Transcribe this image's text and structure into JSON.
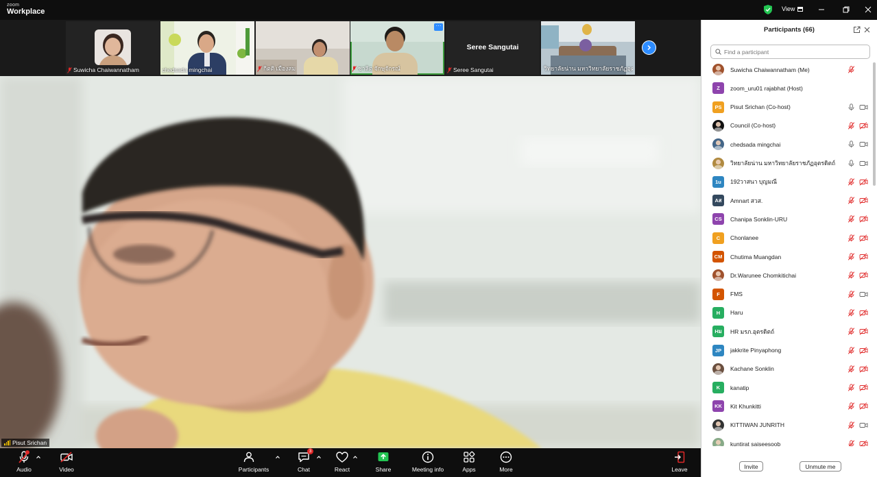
{
  "app": {
    "logo_small": "zoom",
    "logo_big": "Workplace",
    "view_label": "View"
  },
  "colors": {
    "accent": "#2d8cff",
    "muted_red": "#e02828",
    "share_green": "#23c552"
  },
  "thumbnails": [
    {
      "name": "Suwicha Chaiwannatham",
      "muted": true
    },
    {
      "name": "chedsada mingchai",
      "muted": false
    },
    {
      "name": "กิตติ เมืองสม",
      "muted": true
    },
    {
      "name": "ชาลิต จักษุจักรณ์",
      "muted": true
    },
    {
      "name": "Seree Sangutai",
      "muted": true,
      "center_text": "Seree Sangutai"
    },
    {
      "name": "วิทยาลัยน่าน มหาวิทยาลัยราชภัฏอุตรด...",
      "muted": true
    }
  ],
  "main": {
    "speaker_name": "Pisut Srichan"
  },
  "toolbar": {
    "audio": "Audio",
    "video": "Video",
    "participants": "Participants",
    "participants_count": "66",
    "chat": "Chat",
    "chat_badge": "3",
    "react": "React",
    "share": "Share",
    "meeting_info": "Meeting info",
    "apps": "Apps",
    "more": "More",
    "leave": "Leave"
  },
  "panel": {
    "title": "Participants (66)",
    "search_placeholder": "Find a participant",
    "invite": "Invite",
    "unmute_me": "Unmute me",
    "participants": [
      {
        "name": "Suwicha Chaiwannatham (Me)",
        "initials": "",
        "color": "#a0522d",
        "photo": true,
        "mic": "muted",
        "cam": "none"
      },
      {
        "name": "zoom_uru01 rajabhat (Host)",
        "initials": "Z",
        "color": "#8e44ad",
        "photo": false,
        "mic": "none",
        "cam": "none"
      },
      {
        "name": "Pisut Srichan (Co-host)",
        "initials": "PS",
        "color": "#f0a020",
        "photo": false,
        "mic": "on",
        "cam": "on"
      },
      {
        "name": "Council (Co-host)",
        "initials": "",
        "color": "#111111",
        "photo": true,
        "mic": "muted",
        "cam": "off"
      },
      {
        "name": "chedsada mingchai",
        "initials": "",
        "color": "#446688",
        "photo": true,
        "mic": "on",
        "cam": "on"
      },
      {
        "name": "วิทยาลัยน่าน มหาวิทยาลัยราชภัฏอุตรดิตถ์",
        "initials": "",
        "color": "#b08a40",
        "photo": true,
        "mic": "on",
        "cam": "on"
      },
      {
        "name": "192วาสนา บุญมณี",
        "initials": "1u",
        "color": "#2e86c1",
        "photo": false,
        "mic": "muted",
        "cam": "off"
      },
      {
        "name": "Amnart สวส.",
        "initials": "Aส",
        "color": "#34495e",
        "photo": false,
        "mic": "muted",
        "cam": "off"
      },
      {
        "name": "Chanipa Sonklin-URU",
        "initials": "CS",
        "color": "#8e44ad",
        "photo": false,
        "mic": "muted",
        "cam": "off"
      },
      {
        "name": "Chonlanee",
        "initials": "C",
        "color": "#f0a020",
        "photo": false,
        "mic": "muted",
        "cam": "off"
      },
      {
        "name": "Chutima Muangdan",
        "initials": "CM",
        "color": "#d35400",
        "photo": false,
        "mic": "muted",
        "cam": "off"
      },
      {
        "name": "Dr.Warunee Chomkitichai",
        "initials": "",
        "color": "#a0522d",
        "photo": true,
        "mic": "muted",
        "cam": "off"
      },
      {
        "name": "FMS",
        "initials": "F",
        "color": "#d35400",
        "photo": false,
        "mic": "muted",
        "cam": "on"
      },
      {
        "name": "Haru",
        "initials": "H",
        "color": "#27ae60",
        "photo": false,
        "mic": "muted",
        "cam": "off"
      },
      {
        "name": "HR มรภ.อุตรดิตถ์",
        "initials": "Hม",
        "color": "#27ae60",
        "photo": false,
        "mic": "muted",
        "cam": "off"
      },
      {
        "name": "jakkrite Pinyaphong",
        "initials": "JP",
        "color": "#2e86c1",
        "photo": false,
        "mic": "muted",
        "cam": "off"
      },
      {
        "name": "Kachane Sonklin",
        "initials": "",
        "color": "#6b5040",
        "photo": true,
        "mic": "muted",
        "cam": "off"
      },
      {
        "name": "kanatip",
        "initials": "K",
        "color": "#27ae60",
        "photo": false,
        "mic": "muted",
        "cam": "off"
      },
      {
        "name": "Kit Khunkitti",
        "initials": "KK",
        "color": "#8e44ad",
        "photo": false,
        "mic": "muted",
        "cam": "off"
      },
      {
        "name": "KITTIWAN JUNRITH",
        "initials": "",
        "color": "#333333",
        "photo": true,
        "mic": "muted",
        "cam": "on"
      },
      {
        "name": "kuntirat saiseesoob",
        "initials": "",
        "color": "#88aa88",
        "photo": true,
        "mic": "muted",
        "cam": "off"
      }
    ]
  }
}
